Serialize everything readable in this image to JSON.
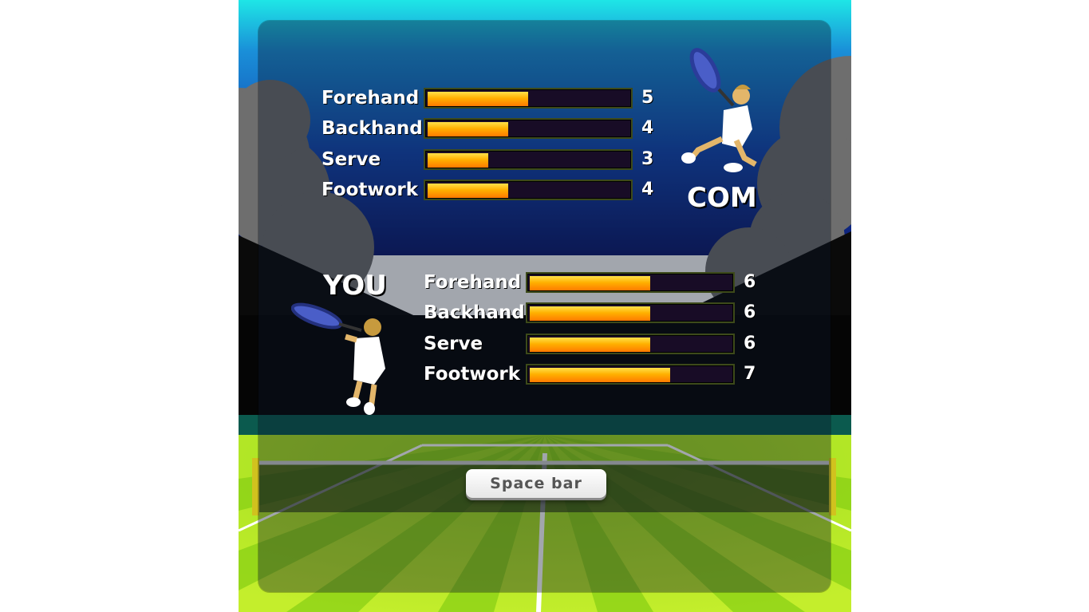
{
  "colors": {
    "sky_top": "#1ee6e6",
    "sky_mid": "#1565c8",
    "sky_bottom": "#0d1a6e",
    "cloud": "#6b6b6b",
    "grass_light": "#b7e62a",
    "grass_dark": "#7fc714",
    "bar_fill_top": "#ffe14a",
    "bar_fill_bottom": "#ff7a00",
    "bar_track": "#180c26",
    "button_text": "#555555"
  },
  "com": {
    "label": "COM",
    "stats": [
      {
        "name": "Forehand",
        "value": "5",
        "level": 0.5
      },
      {
        "name": "Backhand",
        "value": "4",
        "level": 0.4
      },
      {
        "name": "Serve",
        "value": "3",
        "level": 0.3
      },
      {
        "name": "Footwork",
        "value": "4",
        "level": 0.4
      }
    ]
  },
  "you": {
    "label": "YOU",
    "stats": [
      {
        "name": "Forehand",
        "value": "6",
        "level": 0.6
      },
      {
        "name": "Backhand",
        "value": "6",
        "level": 0.6
      },
      {
        "name": "Serve",
        "value": "6",
        "level": 0.6
      },
      {
        "name": "Footwork",
        "value": "7",
        "level": 0.7
      }
    ]
  },
  "button": {
    "label": "Space bar"
  }
}
